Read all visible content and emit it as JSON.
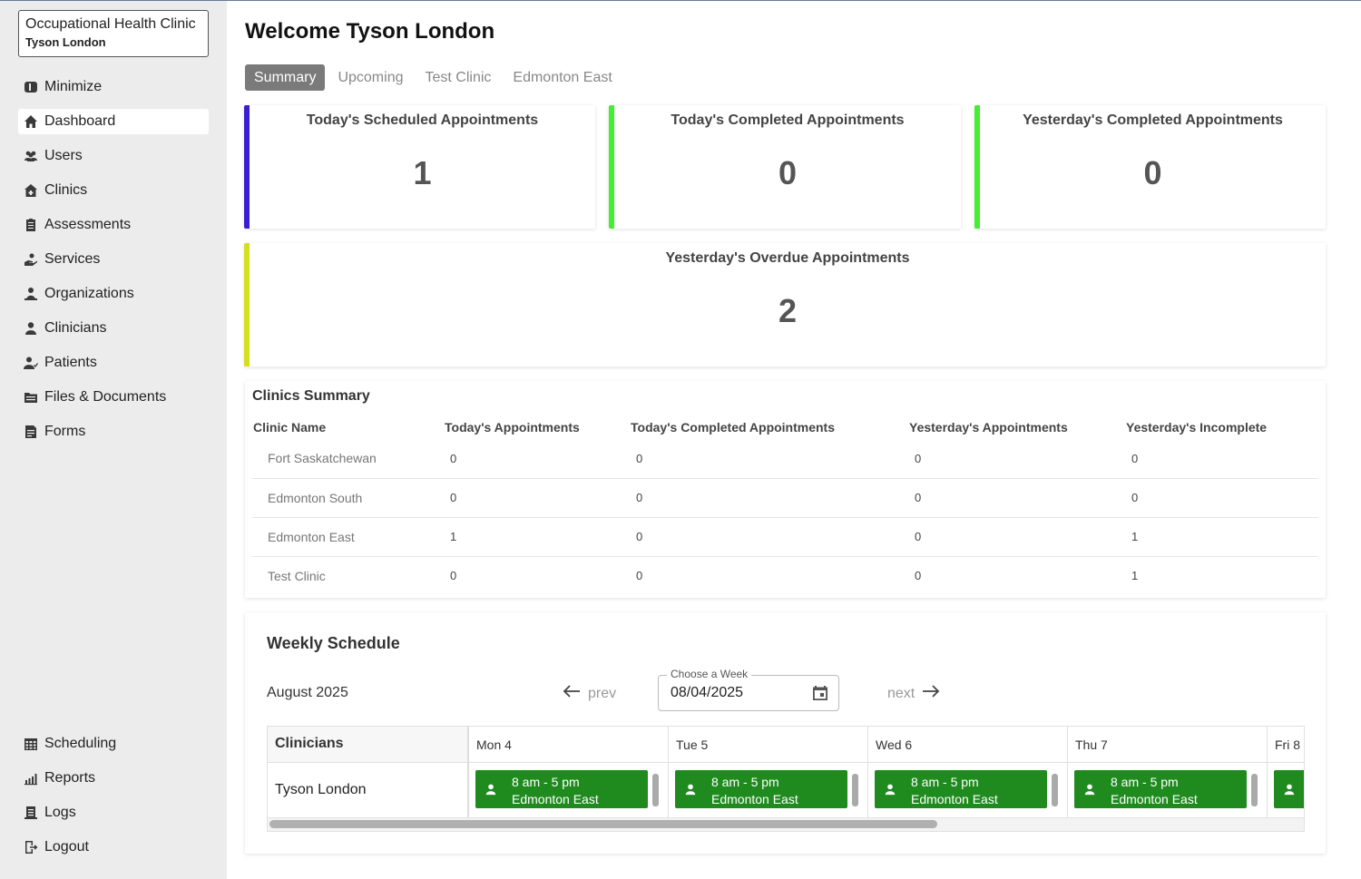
{
  "sidebar": {
    "org_name": "Occupational Health Clinic",
    "user_name": "Tyson London",
    "top_items": [
      {
        "label": "Minimize",
        "icon": "minimize-icon"
      },
      {
        "label": "Dashboard",
        "icon": "home-icon",
        "active": true
      },
      {
        "label": "Users",
        "icon": "users-icon"
      },
      {
        "label": "Clinics",
        "icon": "clinic-icon"
      },
      {
        "label": "Assessments",
        "icon": "clipboard-icon"
      },
      {
        "label": "Services",
        "icon": "hand-service-icon"
      },
      {
        "label": "Organizations",
        "icon": "organization-icon"
      },
      {
        "label": "Clinicians",
        "icon": "clinician-icon"
      },
      {
        "label": "Patients",
        "icon": "patient-icon"
      },
      {
        "label": "Files & Documents",
        "icon": "files-icon"
      },
      {
        "label": "Forms",
        "icon": "form-icon"
      }
    ],
    "bottom_items": [
      {
        "label": "Scheduling",
        "icon": "calendar-grid-icon"
      },
      {
        "label": "Reports",
        "icon": "chart-icon"
      },
      {
        "label": "Logs",
        "icon": "logs-icon"
      },
      {
        "label": "Logout",
        "icon": "logout-icon"
      }
    ]
  },
  "header": {
    "welcome": "Welcome Tyson London"
  },
  "tabs": [
    {
      "label": "Summary",
      "active": true
    },
    {
      "label": "Upcoming"
    },
    {
      "label": "Test Clinic"
    },
    {
      "label": "Edmonton East"
    }
  ],
  "stats": {
    "today_scheduled": {
      "title": "Today's Scheduled Appointments",
      "value": "1",
      "color": "#3a1fd0"
    },
    "today_completed": {
      "title": "Today's Completed Appointments",
      "value": "0",
      "color": "#44ee33"
    },
    "yesterday_completed": {
      "title": "Yesterday's Completed Appointments",
      "value": "0",
      "color": "#44ee33"
    },
    "yesterday_overdue": {
      "title": "Yesterday's Overdue Appointments",
      "value": "2",
      "color": "#d4e01f"
    }
  },
  "clinics_summary": {
    "title": "Clinics Summary",
    "columns": [
      "Clinic Name",
      "Today's Appointments",
      "Today's Completed Appointments",
      "Yesterday's Appointments",
      "Yesterday's Incomplete"
    ],
    "rows": [
      [
        "Fort Saskatchewan",
        "0",
        "0",
        "0",
        "0"
      ],
      [
        "Edmonton South",
        "0",
        "0",
        "0",
        "0"
      ],
      [
        "Edmonton East",
        "1",
        "0",
        "0",
        "1"
      ],
      [
        "Test Clinic",
        "0",
        "0",
        "0",
        "1"
      ]
    ]
  },
  "weekly": {
    "title": "Weekly Schedule",
    "month": "August 2025",
    "prev_label": "prev",
    "next_label": "next",
    "week_label": "Choose a Week",
    "week_value": "08/04/2025",
    "clinicians_header": "Clinicians",
    "days": [
      "Mon 4",
      "Tue 5",
      "Wed 6",
      "Thu 7",
      "Fri 8"
    ],
    "clinician": "Tyson London",
    "event_time": "8 am - 5 pm",
    "event_location": "Edmonton East",
    "event_color": "#1f8b1f"
  }
}
